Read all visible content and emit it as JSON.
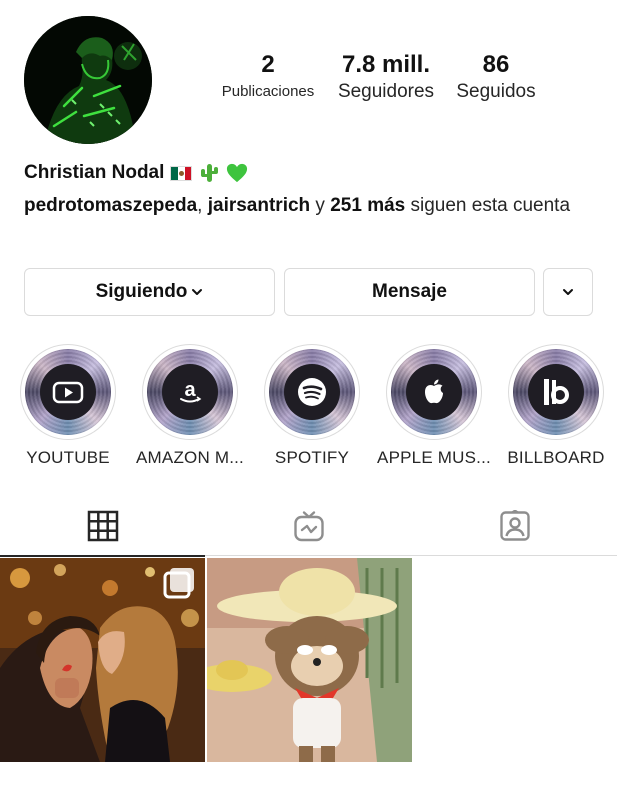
{
  "profile": {
    "name": "Christian Nodal",
    "stats": [
      {
        "value": "2",
        "label": "Publicaciones"
      },
      {
        "value": "7.8 mill.",
        "label": "Seguidores"
      },
      {
        "value": "86",
        "label": "Seguidos"
      }
    ],
    "followed_by": {
      "user1": "pedrotomaszepeda",
      "separator": ", ",
      "user2": "jairsantrich",
      "connector": " y ",
      "more": "251 más",
      "suffix": " siguen esta cuenta"
    }
  },
  "actions": {
    "following_label": "Siguiendo",
    "message_label": "Mensaje"
  },
  "highlights": [
    {
      "label": "YOUTUBE",
      "icon": "youtube-icon"
    },
    {
      "label": "AMAZON M...",
      "icon": "amazon-icon"
    },
    {
      "label": "SPOTIFY",
      "icon": "spotify-icon"
    },
    {
      "label": "APPLE MUS...",
      "icon": "apple-icon"
    },
    {
      "label": "BILLBOARD",
      "icon": "billboard-icon"
    }
  ],
  "tabs": [
    {
      "icon": "grid-icon",
      "active": true
    },
    {
      "icon": "igtv-icon",
      "active": false
    },
    {
      "icon": "tagged-icon",
      "active": false
    }
  ],
  "colors": {
    "text": "#262626",
    "border": "#dbdbdb",
    "avatar_green": "#2fd42f",
    "heart_green": "#3ec43e"
  }
}
